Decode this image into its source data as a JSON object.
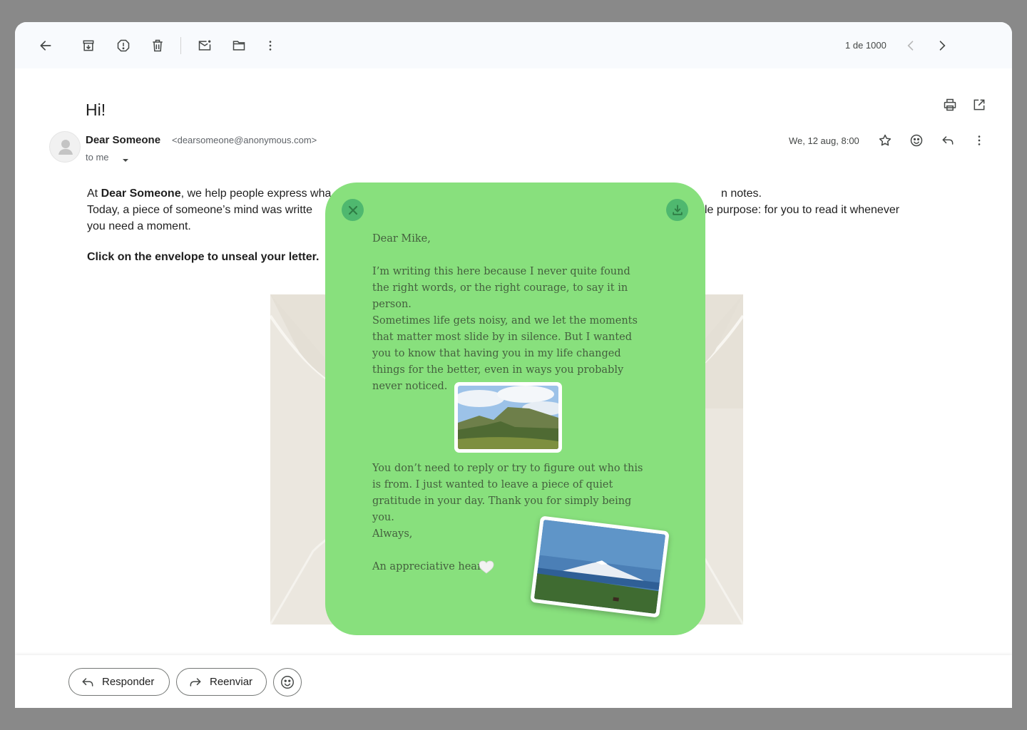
{
  "toolbar": {
    "back": "arrow-left-icon",
    "archive": "archive-icon",
    "spam": "report-spam-icon",
    "delete": "trash-icon",
    "mark_unread": "mark-unread-icon",
    "move": "folder-icon",
    "more": "more-vert-icon",
    "pager_text": "1 de 1000"
  },
  "email": {
    "subject": "Hi!",
    "sender_name": "Dear Someone",
    "sender_email": "<dearsomeone@anonymous.com>",
    "to": "to me",
    "date": "We, 12 aug, 8:00",
    "body_line1_prefix": "At ",
    "body_line1_brand": "Dear Someone",
    "body_line1_rest": ", we help people express wha",
    "body_line1_end": "n notes.",
    "body_line2_start": "Today, a piece of someone’s mind was writte",
    "body_line2_end": "le purpose: for you to read it whenever",
    "body_line3": "you need a moment.",
    "instruction": "Click on the envelope to unseal your letter."
  },
  "actions": {
    "reply_label": "Responder",
    "forward_label": "Reenviar"
  },
  "letter": {
    "background": "#88e07d",
    "greeting": "Dear Mike,",
    "para1": "I’m writing this here because I never quite found the right words, or the right courage, to say it in person.",
    "para2": "Sometimes life gets noisy, and we let the moments that matter most slide by in silence. But I wanted you to know that having you in my life changed things for the better, even in ways you probably never noticed.",
    "para3": "You don’t need to reply or try to figure out who this is from. I just wanted to leave a piece of quiet gratitude in your day. Thank you for simply being you.",
    "closing": "Always,",
    "signature": "An appreciative heart"
  }
}
